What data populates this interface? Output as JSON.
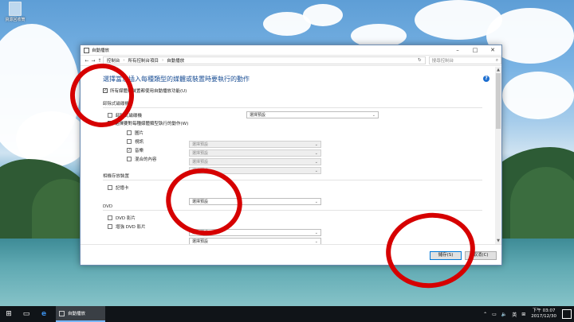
{
  "desktop": {
    "recycle_bin_label": "資源回收筒"
  },
  "window": {
    "title": "自動播放",
    "breadcrumbs": [
      "控制台",
      "所有控制台項目",
      "自動播放"
    ],
    "search_placeholder": "搜尋控制台",
    "heading": "選擇當您插入每種類型的媒體或裝置時要執行的動作",
    "use_autoplay_checkbox": {
      "label": "所有媒體與裝置都使用自動播放功能(U)",
      "checked": true
    },
    "sections": {
      "removable": {
        "title": "卸除式磁碟機",
        "drive_label": "卸除式磁碟機",
        "drive_value": "選擇預設",
        "per_type_checkbox": {
          "label": "選擇要對每種媒體類型執行的動作(W)",
          "checked": false
        },
        "items": [
          {
            "label": "圖片",
            "icon": "picture-icon",
            "value": "選擇預設"
          },
          {
            "label": "視訊",
            "icon": "video-icon",
            "value": "選擇預設"
          },
          {
            "label": "音樂",
            "icon": "music-icon",
            "value": "選擇預設"
          },
          {
            "label": "混合的內容",
            "icon": "mixed-content-icon",
            "value": "選擇預設"
          }
        ]
      },
      "camera": {
        "title": "相機存放裝置",
        "item_label": "記憶卡",
        "item_value": "選擇預設"
      },
      "dvd": {
        "title": "DVD",
        "items": [
          {
            "label": "DVD 影片",
            "value": "選擇預設"
          },
          {
            "label": "增強 DVD 影片",
            "value": "選擇預設"
          }
        ]
      }
    },
    "buttons": {
      "save": "儲存(S)",
      "cancel": "取消(C)"
    }
  },
  "taskbar": {
    "app_label": "自動播放",
    "ime": "英",
    "time": "下午 03:07",
    "date": "2017/12/30"
  },
  "colors": {
    "annotation": "#d60000",
    "heading": "#1b4f95",
    "accent": "#0078d7"
  }
}
